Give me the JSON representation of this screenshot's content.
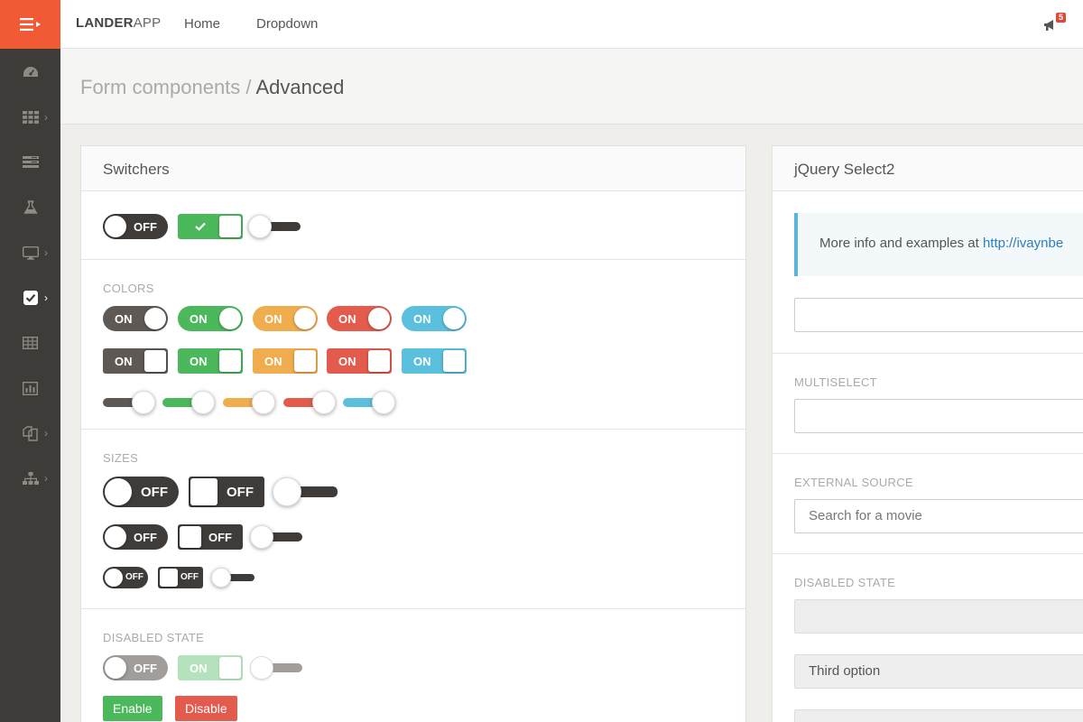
{
  "app": {
    "brand_bold": "LANDER",
    "brand_light": "APP",
    "nav": [
      "Home",
      "Dropdown"
    ],
    "notifications_count": "5"
  },
  "breadcrumb": {
    "parent": "Form components",
    "separator": "/",
    "current": "Advanced"
  },
  "sidebar": {
    "items": [
      {
        "icon": "dashboard-icon",
        "has_arrow": false
      },
      {
        "icon": "grid-icon",
        "has_arrow": true
      },
      {
        "icon": "layout-icon",
        "has_arrow": false
      },
      {
        "icon": "flask-icon",
        "has_arrow": false
      },
      {
        "icon": "monitor-icon",
        "has_arrow": true
      },
      {
        "icon": "checkbox-icon",
        "has_arrow": true,
        "active": true
      },
      {
        "icon": "table-icon",
        "has_arrow": false
      },
      {
        "icon": "bar-chart-icon",
        "has_arrow": false
      },
      {
        "icon": "copy-icon",
        "has_arrow": true
      },
      {
        "icon": "sitemap-icon",
        "has_arrow": true
      }
    ]
  },
  "switchers": {
    "title": "Switchers",
    "off_label": "OFF",
    "on_label": "ON",
    "colors_label": "COLORS",
    "sizes_label": "SIZES",
    "disabled_label": "DISABLED STATE",
    "enable_button": "Enable",
    "disable_button": "Disable",
    "colors": {
      "dark": "#5f5955",
      "green": "#4cb85c",
      "orange": "#f0ad4e",
      "red": "#e35b4d",
      "blue": "#5bc0de"
    }
  },
  "select2": {
    "title": "jQuery Select2",
    "info_text": "More info and examples at ",
    "info_link": "http://ivaynbe",
    "multiselect_label": "MULTISELECT",
    "external_label": "EXTERNAL SOURCE",
    "external_placeholder": "Search for a movie",
    "disabled_label": "DISABLED STATE",
    "third_option": "Third option"
  }
}
